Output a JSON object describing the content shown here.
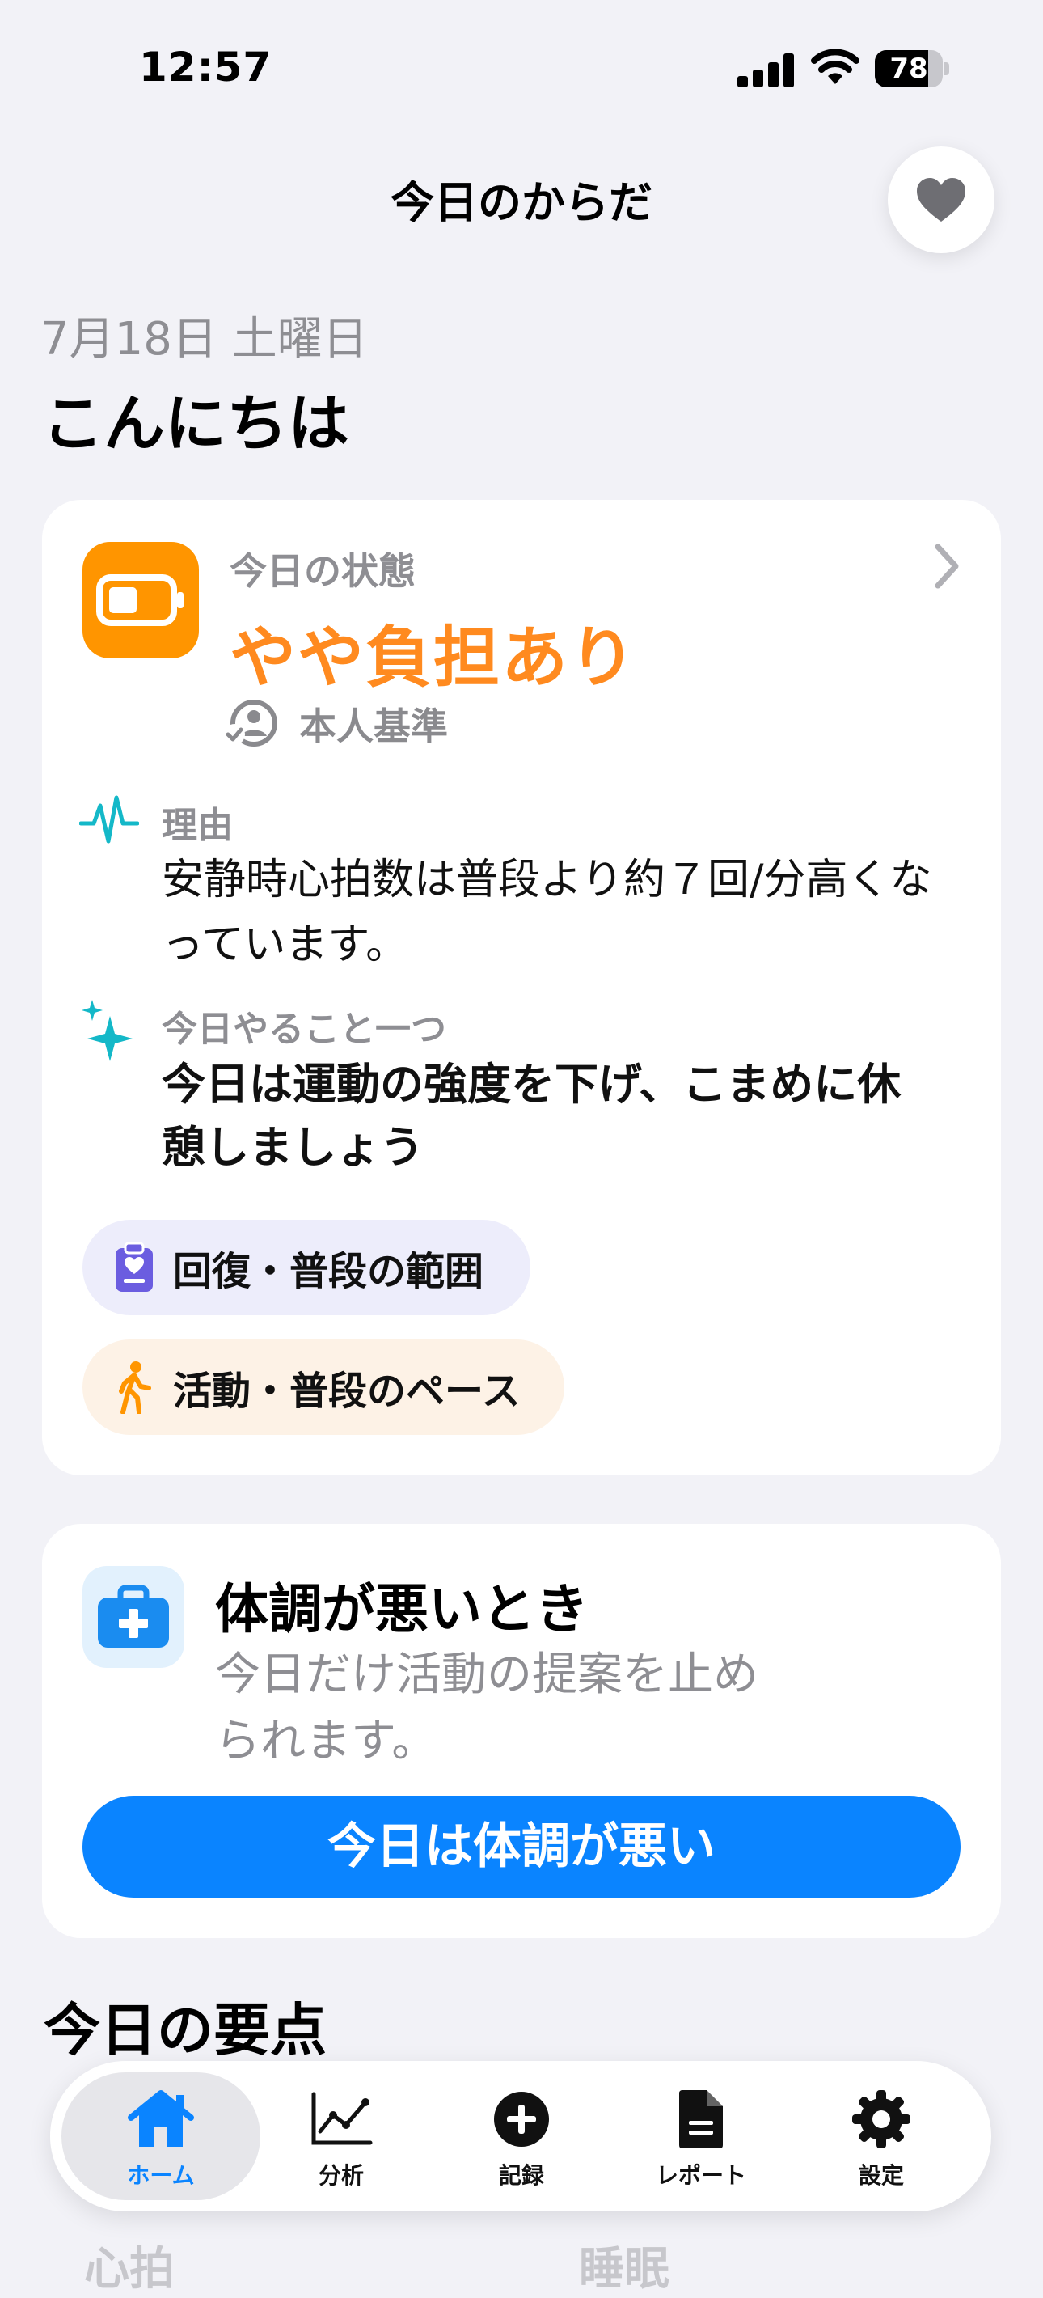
{
  "status_bar": {
    "time": "12:57",
    "battery": "78",
    "battery_level": 0.78
  },
  "header": {
    "title": "今日のからだ"
  },
  "greeting": {
    "date": "7月18日 土曜日",
    "text": "こんにちは"
  },
  "status_card": {
    "label": "今日の状態",
    "value": "やや負担あり",
    "basis": "本人基準",
    "reason_label": "理由",
    "reason_text": "安静時心拍数は普段より約７回/分高くなっています。",
    "todo_label": "今日やること一つ",
    "todo_text": "今日は運動の強度を下げ、こまめに休憩しましょう",
    "chips": [
      {
        "label": "回復・普段の範囲",
        "icon": "clipboard-heart-icon"
      },
      {
        "label": "活動・普段のペース",
        "icon": "walking-icon"
      }
    ],
    "colors": {
      "accent": "#ff8a1f",
      "tile": "#ff9500"
    }
  },
  "sick_card": {
    "title": "体調が悪いとき",
    "description": "今日だけ活動の提案を止められます。",
    "button_label": "今日は体調が悪い",
    "colors": {
      "button": "#0a84ff"
    }
  },
  "summary": {
    "title": "今日の要点",
    "peek_left": "心拍",
    "peek_right": "睡眠"
  },
  "tabbar": {
    "active_color": "#0a84ff",
    "items": [
      {
        "label": "ホーム",
        "icon": "house-icon",
        "active": true
      },
      {
        "label": "分析",
        "icon": "chart-line-icon",
        "active": false
      },
      {
        "label": "記録",
        "icon": "plus-circle-icon",
        "active": false
      },
      {
        "label": "レポート",
        "icon": "document-icon",
        "active": false
      },
      {
        "label": "設定",
        "icon": "gear-icon",
        "active": false
      }
    ]
  }
}
